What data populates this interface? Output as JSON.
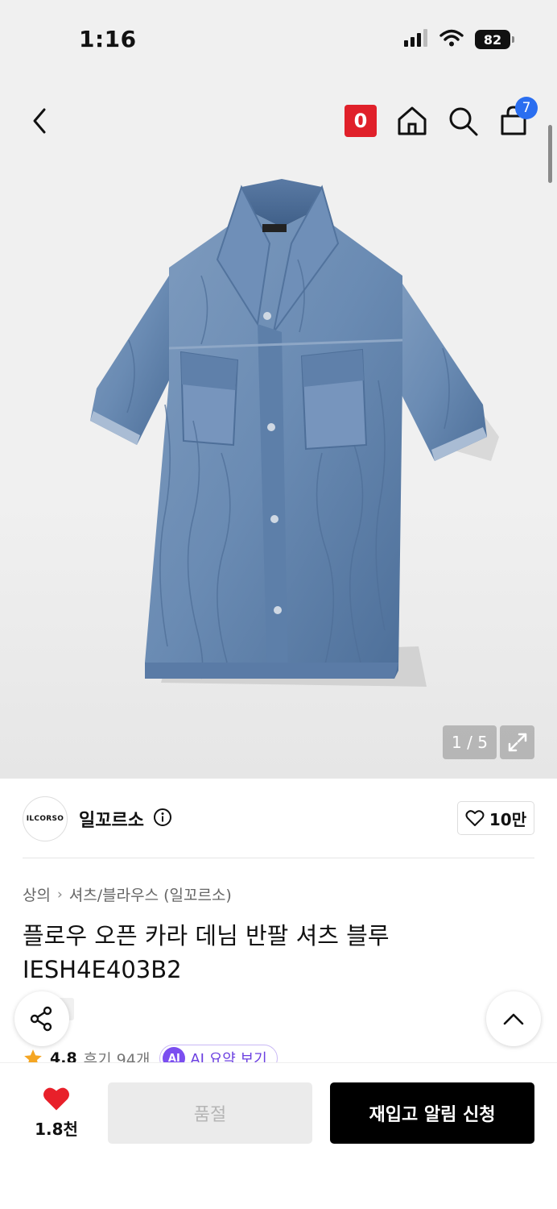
{
  "status_bar": {
    "time": "1:16",
    "battery": "82",
    "icons": [
      "signal-icon",
      "wifi-icon",
      "battery-icon"
    ]
  },
  "nav": {
    "back_icon": "chevron-left-icon",
    "brand_badge": "0",
    "icons": [
      "home-icon",
      "search-icon",
      "shopping-bag-icon"
    ],
    "cart_count": "7"
  },
  "gallery": {
    "counter": "1 / 5",
    "expand_icon": "expand-icon"
  },
  "brand": {
    "logo_text": "ILCORSO",
    "name": "일꼬르소",
    "likes": "10만"
  },
  "breadcrumb": {
    "category": "상의",
    "subcategory": "셔츠/블라우스 (일꼬르소)"
  },
  "product": {
    "title": "플로우 오픈 카라 데님 반팔 셔츠 블루 IESH4E403B2",
    "rating": "4.8",
    "review_label": "후기 94개",
    "ai_chip": "AI",
    "ai_summary": "AI 요약 보기"
  },
  "bottom_bar": {
    "wish_count": "1.8천",
    "soldout_label": "품절",
    "restock_label": "재입고 알림 신청"
  },
  "colors": {
    "brand_red": "#e0202a",
    "badge_blue": "#2a6ef0",
    "wish_red": "#e8202a",
    "ai_purple": "#7b4ef0",
    "star_orange": "#f5a623"
  }
}
